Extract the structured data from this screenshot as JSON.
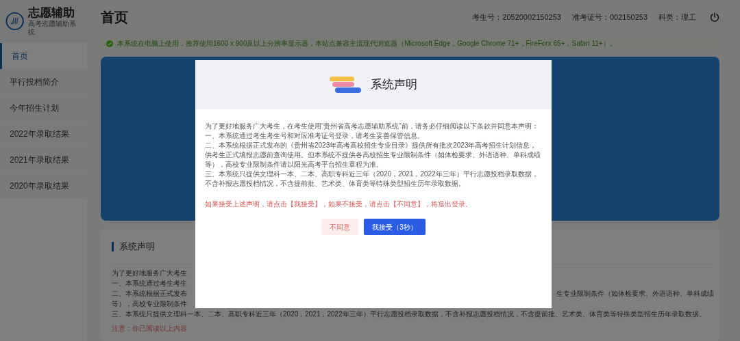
{
  "sidebar": {
    "logo": {
      "title": "志愿辅助",
      "subtitle": "高考志愿辅助系统"
    },
    "items": [
      {
        "label": "首页",
        "selected": true
      },
      {
        "label": "平行投档简介",
        "selected": false
      },
      {
        "label": "今年招生计划",
        "selected": false
      },
      {
        "label": "2022年录取结果",
        "selected": false
      },
      {
        "label": "2021年录取结果",
        "selected": false
      },
      {
        "label": "2020年录取结果",
        "selected": false
      }
    ]
  },
  "header": {
    "title": "首页",
    "info": [
      "考生号：20520002150253",
      "准考证号：002150253",
      "科类：理工"
    ]
  },
  "notice": "本系统在电脑上使用，推荐使用1600 x 900及以上分辨率显示器，本站点兼容主流现代浏览器（Microsoft Edge，Google Chrome 71+，FireForx 65+，Safari 11+）。",
  "card": {
    "title": "系统声明",
    "rows": [
      {
        "left": "为了更好地服务广大考生"
      },
      {
        "left": "一、本系统通过考生考生"
      },
      {
        "left": "二、本系统根据正式发布",
        "right": "生专业限制条件（如体检要求、外语语种、单科成绩"
      },
      {
        "left": "等），高校专业限制条件"
      }
    ],
    "line": "三、本系统只提供文理科一本、二本、高职专科近三年（2020，2021，2022年三年）平行志愿投档录取数据，不含补报志愿投档情况，不含提前批、艺术类、体育类等特殊类型招生历年录取数据。",
    "note": "注意：你已阅读以上内容"
  },
  "modal": {
    "title": "系统声明",
    "paragraphs": [
      "为了更好地服务广大考生，在考生使用“贵州省高考志愿辅助系统”前，请务必仔细阅读以下条款并同意本声明：",
      "一、本系统通过考生考生号和对应准考证号登录，请考生妥善保管信息。",
      "二、本系统根据正式发布的《贵州省2023年高考高校招生专业目录》提供所有批次2023年高考招生计划信息，供考生正式填报志愿前查询使用。但本系统不提供各高校招生专业限制条件（如体检要求、外语语种、单科成绩等），高校专业限制条件请以阳光高考平台招生章程为准。",
      "三、本系统只提供文理科一本、二本、高职专科近三年（2020，2021，2022年三年）平行志愿投档录取数据，不含补报志愿投档情况，不含提前批、艺术类、体育类等特殊类型招生历年录取数据。"
    ],
    "warning": "如果接受上述声明，请点击【我接受】，如果不接受，请点击【不同意】，将退出登录。",
    "buttons": [
      {
        "label": "不同意",
        "kind": "decline"
      },
      {
        "label": "我接受（3秒）",
        "kind": "accept"
      }
    ]
  }
}
